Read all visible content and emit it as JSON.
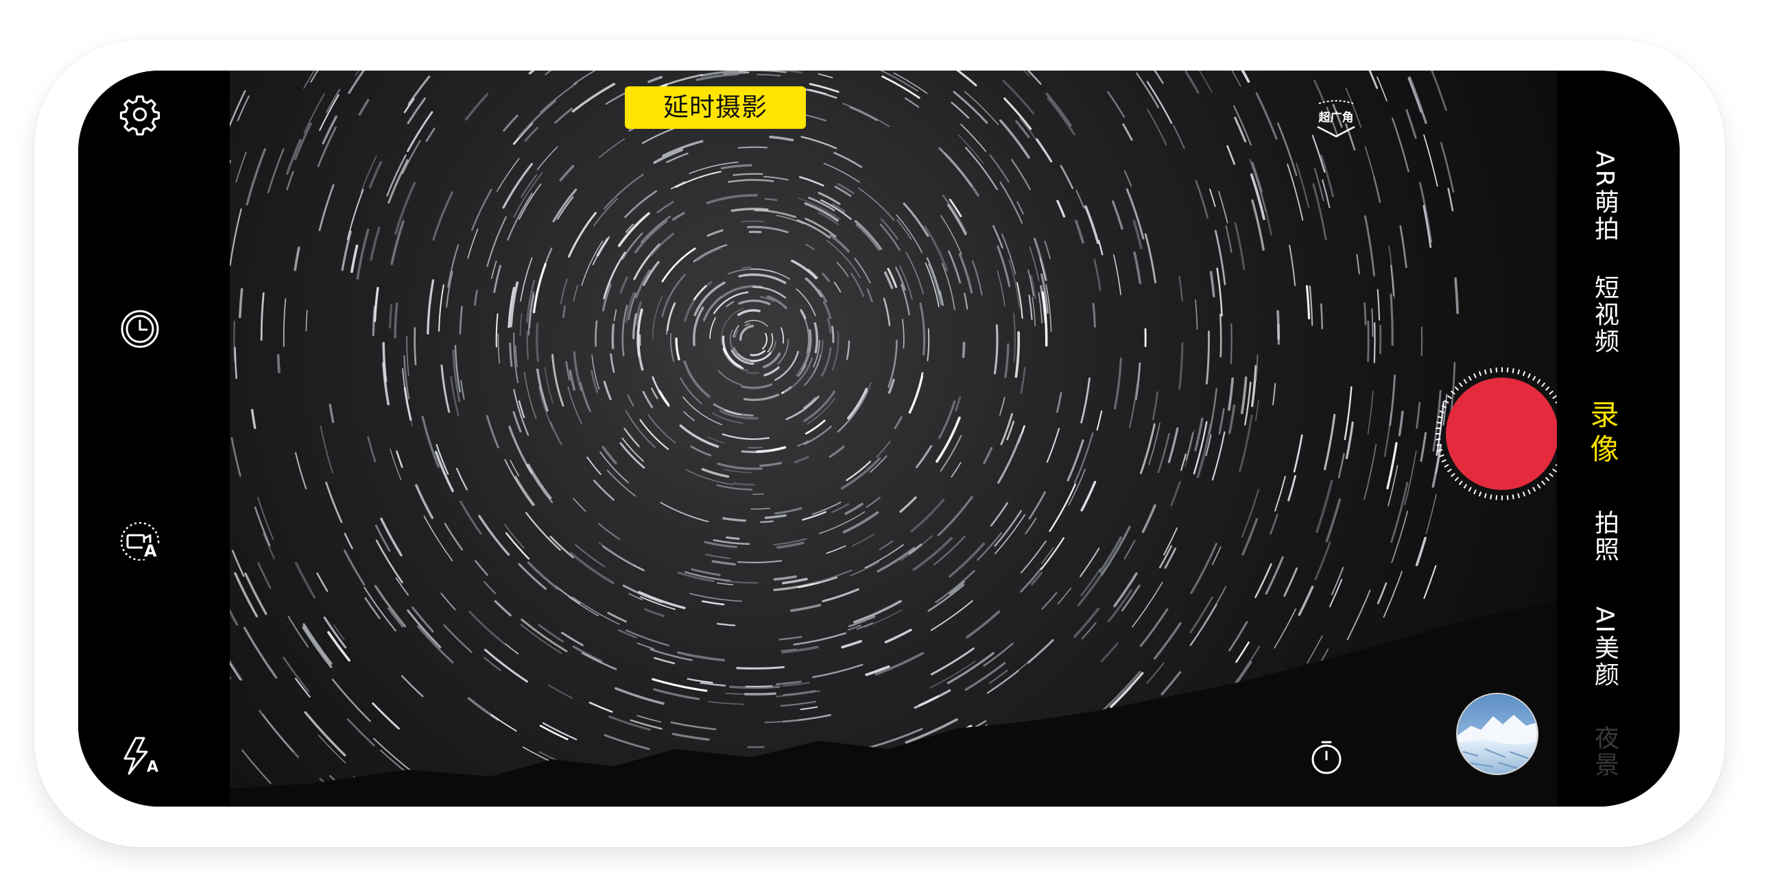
{
  "top_banner": {
    "mode_label": "延时摄影"
  },
  "left_toolbar": {
    "icons": [
      "gear-icon",
      "clock-icon",
      "video-camera-auto-icon",
      "flash-auto-icon"
    ],
    "video_auto_badge": "A",
    "flash_auto_badge": "A"
  },
  "viewfinder": {
    "wide_angle_label": "超广角",
    "scene": "star trails over mountain silhouette"
  },
  "controls": {
    "record_color": "#e42a3d",
    "icons": [
      "stopwatch-icon"
    ]
  },
  "mode_selector": {
    "items": [
      {
        "label": "AR萌拍",
        "state": "normal"
      },
      {
        "label": "短视频",
        "state": "normal"
      },
      {
        "label": "录像",
        "state": "active"
      },
      {
        "label": "拍照",
        "state": "normal"
      },
      {
        "label": "AI美颜",
        "state": "normal"
      },
      {
        "label": "夜景",
        "state": "faded"
      }
    ]
  },
  "colors": {
    "accent_yellow": "#ffe500",
    "record_red": "#e42a3d",
    "background": "#000000"
  }
}
